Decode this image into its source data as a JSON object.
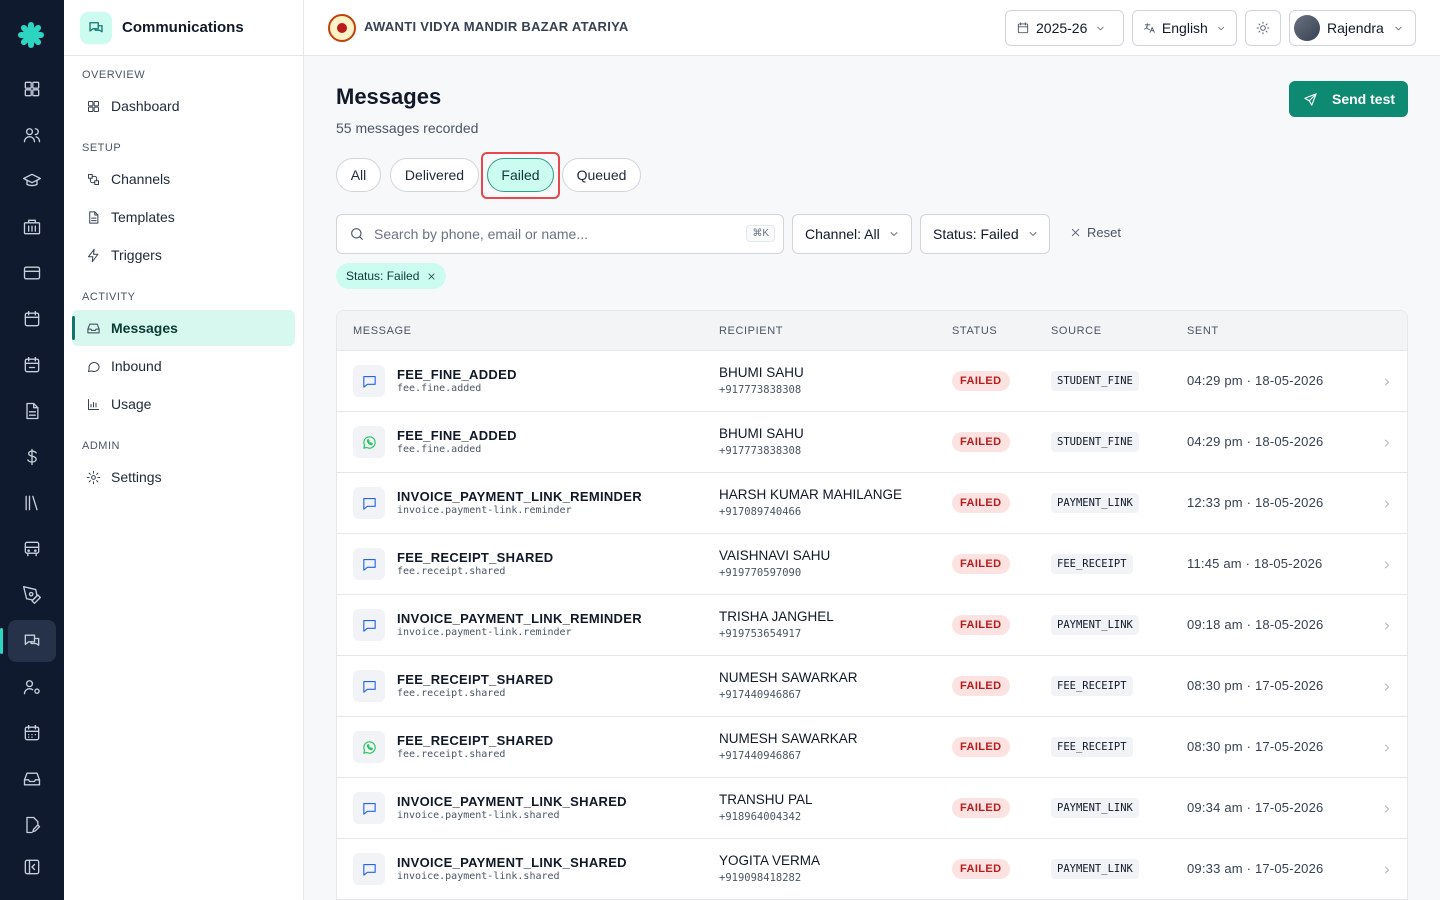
{
  "app": {
    "section_title": "Communications",
    "school_name": "AWANTI VIDYA MANDIR BAZAR ATARIYA"
  },
  "rail": {
    "icons": [
      "dashboard-icon",
      "users-icon",
      "graduation-cap-icon",
      "building-icon",
      "credit-card-icon",
      "calendar-icon",
      "calendar-alt-icon",
      "file-text-icon",
      "dollar-icon",
      "library-icon",
      "bus-icon",
      "pen-tool-icon",
      "messages-icon",
      "user-cog-icon",
      "calendar-grid-icon",
      "inbox-icon",
      "file-edit-icon",
      "collapse-sidebar-icon"
    ],
    "active_index": 12
  },
  "sidebar": {
    "sections": [
      {
        "label": "OVERVIEW",
        "items": [
          {
            "label": "Dashboard",
            "icon": "grid-icon"
          }
        ]
      },
      {
        "label": "SETUP",
        "items": [
          {
            "label": "Channels",
            "icon": "channels-icon"
          },
          {
            "label": "Templates",
            "icon": "file-icon"
          },
          {
            "label": "Triggers",
            "icon": "zap-icon"
          }
        ]
      },
      {
        "label": "ACTIVITY",
        "items": [
          {
            "label": "Messages",
            "icon": "inbox-icon",
            "active": true
          },
          {
            "label": "Inbound",
            "icon": "message-circle-icon"
          },
          {
            "label": "Usage",
            "icon": "bar-chart-icon"
          }
        ]
      },
      {
        "label": "ADMIN",
        "items": [
          {
            "label": "Settings",
            "icon": "gear-icon"
          }
        ]
      }
    ]
  },
  "topbar": {
    "year": "2025-26",
    "language": "English",
    "user": "Rajendra"
  },
  "page": {
    "title": "Messages",
    "subtitle": "55 messages recorded",
    "send_test": "Send test",
    "tabs": [
      "All",
      "Delivered",
      "Failed",
      "Queued"
    ],
    "active_tab": "Failed",
    "search_placeholder": "Search by phone, email or name...",
    "search_shortcut": "⌘K",
    "channel_filter": "Channel: All",
    "status_filter": "Status: Failed",
    "reset": "Reset",
    "active_chip": "Status: Failed"
  },
  "table": {
    "columns": [
      "MESSAGE",
      "RECIPIENT",
      "STATUS",
      "SOURCE",
      "SENT"
    ],
    "rows": [
      {
        "channel": "sms",
        "template": "FEE_FINE_ADDED",
        "event": "fee.fine.added",
        "name": "BHUMI SAHU",
        "phone": "+917773838308",
        "status": "FAILED",
        "source": "STUDENT_FINE",
        "sent": "04:29 pm · 18-05-2026"
      },
      {
        "channel": "whatsapp",
        "template": "FEE_FINE_ADDED",
        "event": "fee.fine.added",
        "name": "BHUMI SAHU",
        "phone": "+917773838308",
        "status": "FAILED",
        "source": "STUDENT_FINE",
        "sent": "04:29 pm · 18-05-2026"
      },
      {
        "channel": "sms",
        "template": "INVOICE_PAYMENT_LINK_REMINDER",
        "event": "invoice.payment-link.reminder",
        "name": "HARSH KUMAR MAHILANGE",
        "phone": "+917089740466",
        "status": "FAILED",
        "source": "PAYMENT_LINK",
        "sent": "12:33 pm · 18-05-2026"
      },
      {
        "channel": "sms",
        "template": "FEE_RECEIPT_SHARED",
        "event": "fee.receipt.shared",
        "name": "VAISHNAVI SAHU",
        "phone": "+919770597090",
        "status": "FAILED",
        "source": "FEE_RECEIPT",
        "sent": "11:45 am · 18-05-2026"
      },
      {
        "channel": "sms",
        "template": "INVOICE_PAYMENT_LINK_REMINDER",
        "event": "invoice.payment-link.reminder",
        "name": "TRISHA JANGHEL",
        "phone": "+919753654917",
        "status": "FAILED",
        "source": "PAYMENT_LINK",
        "sent": "09:18 am · 18-05-2026"
      },
      {
        "channel": "sms",
        "template": "FEE_RECEIPT_SHARED",
        "event": "fee.receipt.shared",
        "name": "NUMESH SAWARKAR",
        "phone": "+917440946867",
        "status": "FAILED",
        "source": "FEE_RECEIPT",
        "sent": "08:30 pm · 17-05-2026"
      },
      {
        "channel": "whatsapp",
        "template": "FEE_RECEIPT_SHARED",
        "event": "fee.receipt.shared",
        "name": "NUMESH SAWARKAR",
        "phone": "+917440946867",
        "status": "FAILED",
        "source": "FEE_RECEIPT",
        "sent": "08:30 pm · 17-05-2026"
      },
      {
        "channel": "sms",
        "template": "INVOICE_PAYMENT_LINK_SHARED",
        "event": "invoice.payment-link.shared",
        "name": "TRANSHU PAL",
        "phone": "+918964004342",
        "status": "FAILED",
        "source": "PAYMENT_LINK",
        "sent": "09:34 am · 17-05-2026"
      },
      {
        "channel": "sms",
        "template": "INVOICE_PAYMENT_LINK_SHARED",
        "event": "invoice.payment-link.shared",
        "name": "YOGITA VERMA",
        "phone": "+919098418282",
        "status": "FAILED",
        "source": "PAYMENT_LINK",
        "sent": "09:33 am · 17-05-2026"
      }
    ]
  },
  "colors": {
    "accent": "#0f8a72",
    "accent_light": "#ccfbef",
    "failed_bg": "#fde2e2",
    "failed_text": "#b91c1c",
    "rail_bg": "#0f1a2e",
    "sms_icon": "#2563eb",
    "whatsapp_icon": "#22c55e",
    "highlight": "#e5484d"
  }
}
